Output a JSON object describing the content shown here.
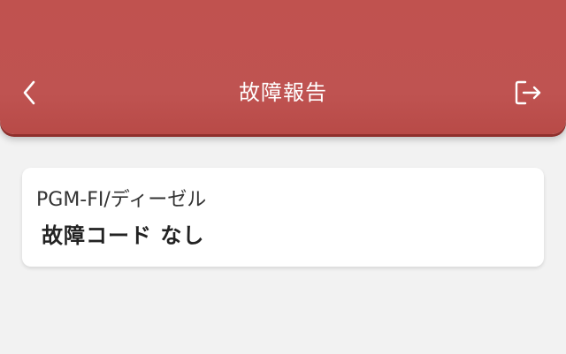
{
  "header": {
    "title": "故障報告",
    "back_icon": "chevron-left-icon",
    "logout_icon": "logout-icon",
    "background_color": "#c0524f"
  },
  "report": {
    "system": "PGM-FI/ディーゼル",
    "status": "故障コード なし"
  }
}
